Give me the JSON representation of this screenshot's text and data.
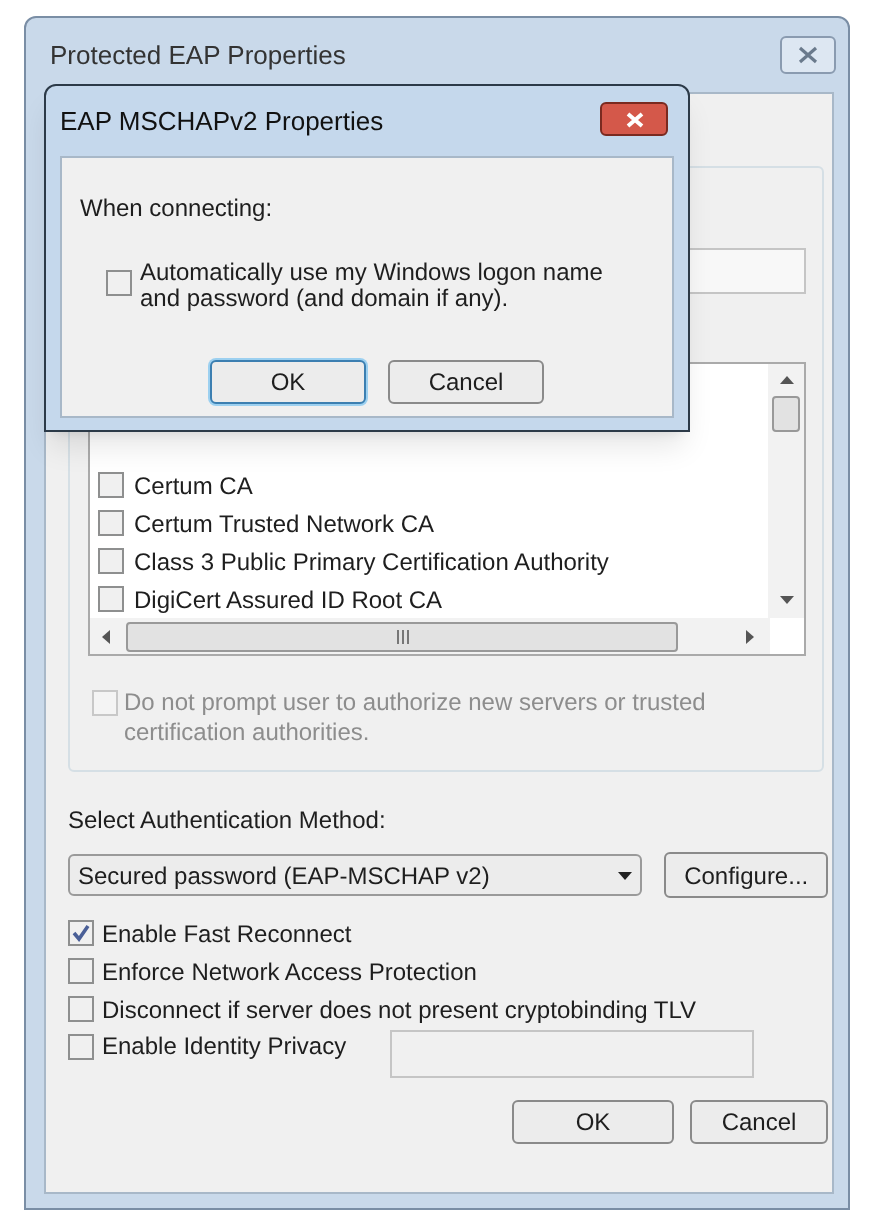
{
  "main_window": {
    "title": "Protected EAP Properties",
    "ca_list": [
      {
        "label": "Certum CA",
        "checked": false
      },
      {
        "label": "Certum Trusted Network CA",
        "checked": false
      },
      {
        "label": "Class 3 Public Primary Certification Authority",
        "checked": false
      },
      {
        "label": "DigiCert Assured ID Root CA",
        "checked": false
      }
    ],
    "no_prompt": {
      "label": "Do not prompt user to authorize new servers or trusted certification authorities.",
      "checked": false,
      "disabled": true
    },
    "auth_method_label": "Select Authentication Method:",
    "auth_method": "Secured password (EAP-MSCHAP v2)",
    "configure_button": "Configure...",
    "options": [
      {
        "label": "Enable Fast Reconnect",
        "checked": true
      },
      {
        "label": "Enforce Network Access Protection",
        "checked": false
      },
      {
        "label": "Disconnect if server does not present cryptobinding TLV",
        "checked": false
      },
      {
        "label": "Enable Identity Privacy",
        "checked": false
      }
    ],
    "buttons": [
      "OK",
      "Cancel"
    ]
  },
  "dialog": {
    "title": "EAP MSCHAPv2 Properties",
    "prompt": "When connecting:",
    "auto_logon": {
      "label": "Automatically use my Windows logon name and password (and domain if any).",
      "checked": false
    },
    "buttons": [
      "OK",
      "Cancel"
    ]
  }
}
